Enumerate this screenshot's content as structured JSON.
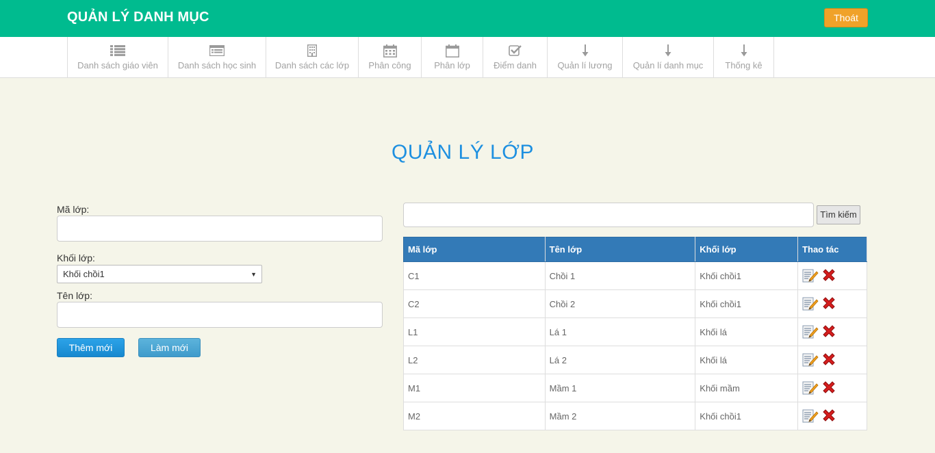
{
  "header": {
    "brand": "QUẢN LÝ DANH MỤC",
    "logout_label": "Thoát"
  },
  "nav": {
    "items": [
      {
        "label": "Danh sách giáo viên",
        "icon": "list-icon"
      },
      {
        "label": "Danh sách học sinh",
        "icon": "card-list-icon"
      },
      {
        "label": "Danh sách các lớp",
        "icon": "building-icon"
      },
      {
        "label": "Phân công",
        "icon": "calendar-icon"
      },
      {
        "label": "Phân lớp",
        "icon": "calendar-blank-icon"
      },
      {
        "label": "Điểm danh",
        "icon": "check-square-icon"
      },
      {
        "label": "Quản lí lương",
        "icon": "arrow-down-icon"
      },
      {
        "label": "Quản lí danh mục",
        "icon": "arrow-down-icon"
      },
      {
        "label": "Thống kê",
        "icon": "arrow-down-icon"
      }
    ]
  },
  "page": {
    "title": "QUẢN LÝ LỚP"
  },
  "form": {
    "code_label": "Mã lớp:",
    "code_value": "",
    "grade_label": "Khối lớp:",
    "grade_selected": "Khối chồi1",
    "name_label": "Tên lớp:",
    "name_value": "",
    "add_label": "Thêm mới",
    "reset_label": "Làm mới"
  },
  "search": {
    "value": "",
    "button_label": "Tìm kiếm"
  },
  "table": {
    "headers": [
      "Mã lớp",
      "Tên lớp",
      "Khối lớp",
      "Thao tác"
    ],
    "rows": [
      [
        "C1",
        "Chồi 1",
        "Khối chồi1"
      ],
      [
        "C2",
        "Chồi 2",
        "Khối chồi1"
      ],
      [
        "L1",
        "Lá 1",
        "Khối lá"
      ],
      [
        "L2",
        "Lá 2",
        "Khối lá"
      ],
      [
        "M1",
        "Mầm 1",
        "Khối mầm"
      ],
      [
        "M2",
        "Mầm 2",
        "Khối chồi1"
      ]
    ]
  },
  "colors": {
    "header_bg": "#00bb8f",
    "logout_bg": "#f0a229",
    "title": "#1e90e0",
    "table_header": "#337ab7",
    "page_bg": "#f5f5e9"
  }
}
